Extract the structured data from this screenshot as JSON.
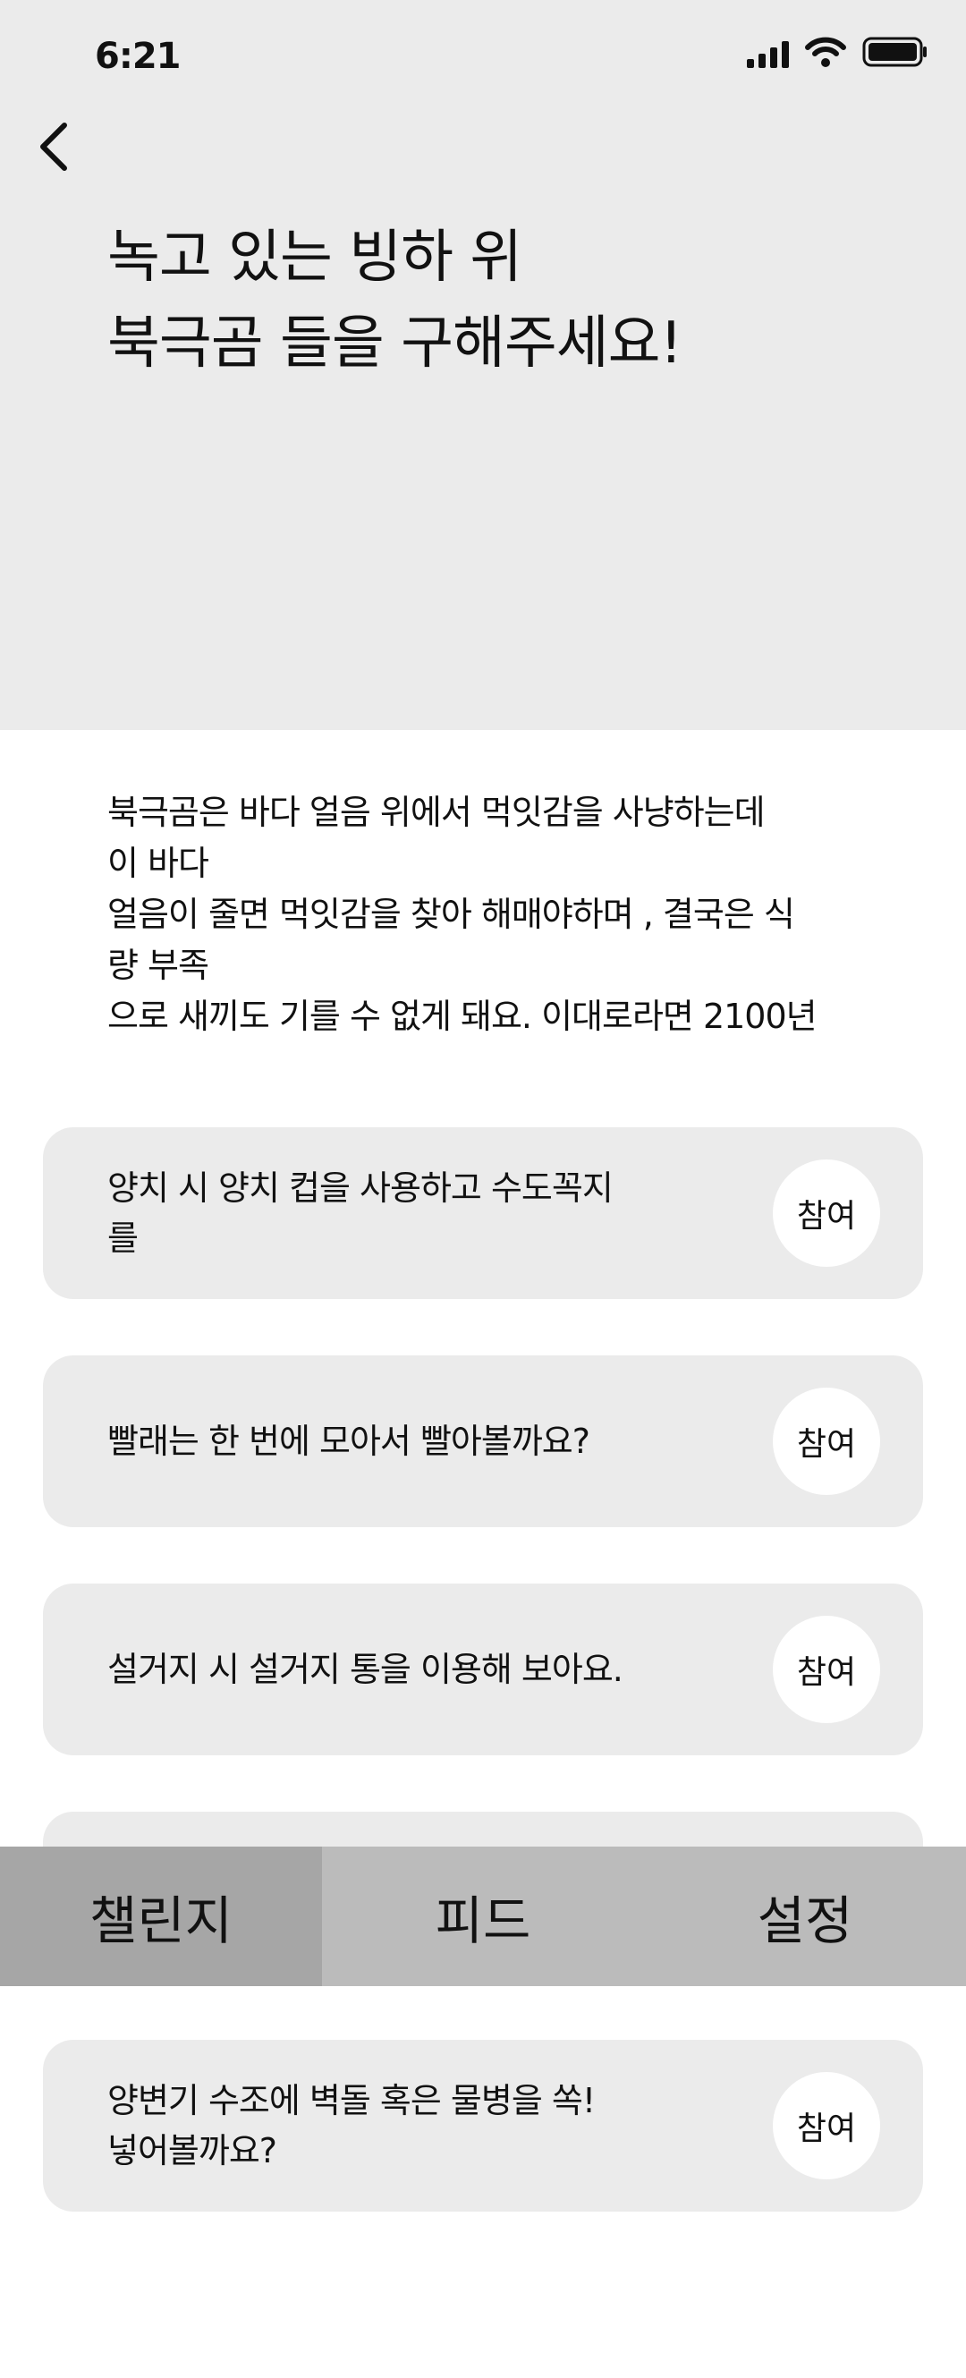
{
  "status_bar": {
    "time": "6:21"
  },
  "icons": {
    "back": "chevron-left-icon",
    "signal": "cellular-signal-icon",
    "wifi": "wifi-icon",
    "battery": "battery-icon"
  },
  "hero": {
    "title_lines": [
      "녹고 있는 빙하 위",
      "북극곰 들을 구해주세요!"
    ],
    "background": "#ebebeb"
  },
  "description_lines": [
    "북극곰은 바다 얼음 위에서 먹잇감을 사냥하는데",
    "이 바다",
    "얼음이 줄면 먹잇감을 찾아 해매야하며 , 결국은 식",
    "량 부족",
    "으로 새끼도 기를 수 없게 돼요. 이대로라면 2100년"
  ],
  "challenges": [
    {
      "lines": [
        "양치 시 양치 컵을 사용하고 수도꼭지",
        "를"
      ],
      "button": "참여"
    },
    {
      "lines": [
        "빨래는 한 번에 모아서 빨아볼까요?"
      ],
      "button": "참여"
    },
    {
      "lines": [
        "설거지 시 설거지 통을 이용해 보아요."
      ],
      "button": "참여"
    },
    {
      "lines": [
        "양변기 수조에 벽돌 혹은 물병을 쏙!",
        "넣어볼까요?"
      ],
      "button": "참여"
    }
  ],
  "tabs": [
    {
      "label": "챌린지",
      "active": true
    },
    {
      "label": "피드",
      "active": false
    },
    {
      "label": "설정",
      "active": false
    }
  ],
  "colors": {
    "card_bg": "#ebebeb",
    "tab_bar_bg": "#bbbbbb",
    "tab_active_bg": "#a6a6a6"
  }
}
